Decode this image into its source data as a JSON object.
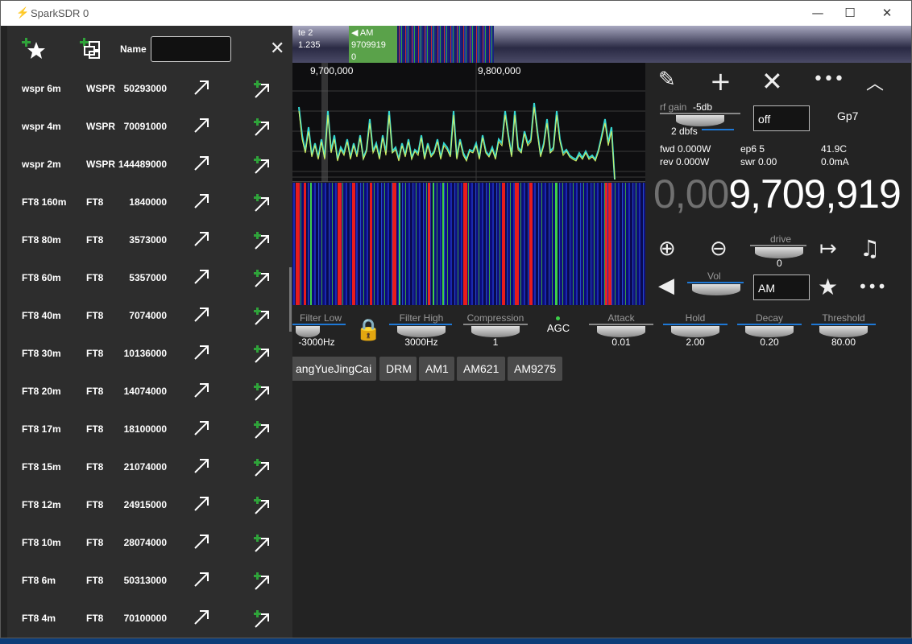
{
  "window": {
    "title": "SparkSDR  0",
    "minimize": "—",
    "maximize": "☐",
    "close": "✕"
  },
  "top_strip": {
    "rx_tab_line1": "te 2",
    "rx_tab_line2": "1.235",
    "am_tab_mode": "AM",
    "am_tab_freq": "9709919",
    "am_tab_extra": "0"
  },
  "spectrum": {
    "freq_labels": [
      "9,700,000",
      "9,800,000"
    ]
  },
  "controls": {
    "rf_gain_label": "rf gain",
    "rf_gain_value": "-5db",
    "dbfs": "2 dbfs",
    "preamp_select": "off",
    "radio_name": "Gp7",
    "fwd": "fwd 0.000W",
    "rev": "rev 0.000W",
    "ep6": "ep6 5",
    "swr": "swr 0.00",
    "temp": "41.9C",
    "current": "0.0mA",
    "freq_dim": "0,00",
    "freq_bright": "9,709,919",
    "drive_label": "drive",
    "drive_value": "0",
    "vol_label": "Vol",
    "mode_select": "AM"
  },
  "dsp": {
    "filter_low_label": "Filter Low",
    "filter_low_value": "-3000Hz",
    "filter_high_label": "Filter High",
    "filter_high_value": "3000Hz",
    "compression_label": "Compression",
    "compression_value": "1",
    "agc_label": "AGC",
    "attack_label": "Attack",
    "attack_value": "0.01",
    "hold_label": "Hold",
    "hold_value": "2.00",
    "decay_label": "Decay",
    "decay_value": "0.20",
    "threshold_label": "Threshold",
    "threshold_value": "80.00"
  },
  "presets": [
    "angYueJingCai",
    "DRM",
    "AM1",
    "AM621",
    "AM9275"
  ],
  "sidebar": {
    "name_label": "Name",
    "name_value": "",
    "rows": [
      {
        "name": "wspr 6m",
        "mode": "WSPR",
        "freq": "50293000"
      },
      {
        "name": "wspr 4m",
        "mode": "WSPR",
        "freq": "70091000"
      },
      {
        "name": "wspr 2m",
        "mode": "WSPR",
        "freq": "144489000"
      },
      {
        "name": "FT8 160m",
        "mode": "FT8",
        "freq": "1840000"
      },
      {
        "name": "FT8 80m",
        "mode": "FT8",
        "freq": "3573000"
      },
      {
        "name": "FT8 60m",
        "mode": "FT8",
        "freq": "5357000"
      },
      {
        "name": "FT8 40m",
        "mode": "FT8",
        "freq": "7074000"
      },
      {
        "name": "FT8 30m",
        "mode": "FT8",
        "freq": "10136000"
      },
      {
        "name": "FT8 20m",
        "mode": "FT8",
        "freq": "14074000"
      },
      {
        "name": "FT8 17m",
        "mode": "FT8",
        "freq": "18100000"
      },
      {
        "name": "FT8 15m",
        "mode": "FT8",
        "freq": "21074000"
      },
      {
        "name": "FT8 12m",
        "mode": "FT8",
        "freq": "24915000"
      },
      {
        "name": "FT8 10m",
        "mode": "FT8",
        "freq": "28074000"
      },
      {
        "name": "FT8 6m",
        "mode": "FT8",
        "freq": "50313000"
      },
      {
        "name": "FT8 4m",
        "mode": "FT8",
        "freq": "70100000"
      }
    ]
  },
  "colors": {
    "accent_green": "#5aa24a",
    "accent_blue": "#1e78d6",
    "waterfall_red": "#e81c1c"
  }
}
